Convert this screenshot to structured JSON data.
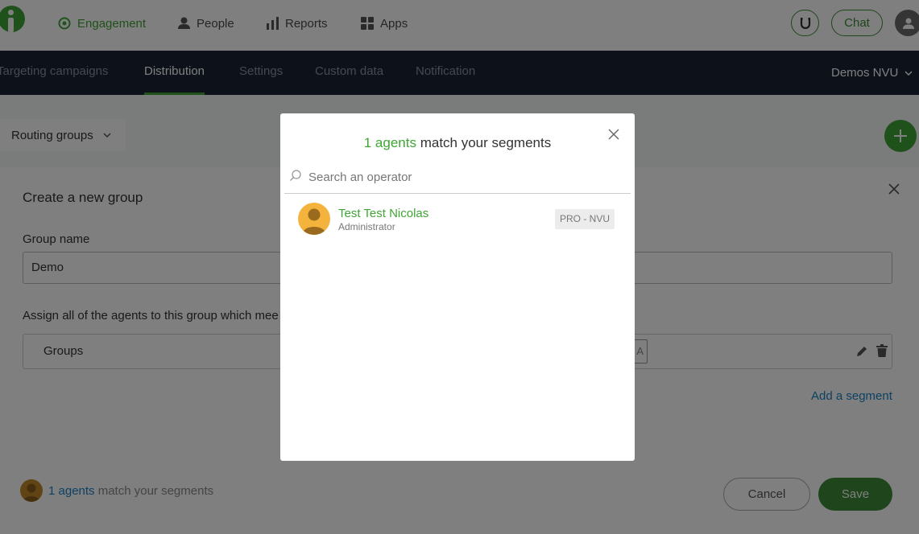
{
  "topnav": {
    "items": [
      {
        "label": "Engagement",
        "icon": "target-icon",
        "active": true
      },
      {
        "label": "People",
        "icon": "person-icon",
        "active": false
      },
      {
        "label": "Reports",
        "icon": "bar-chart-icon",
        "active": false
      },
      {
        "label": "Apps",
        "icon": "grid-icon",
        "active": false
      }
    ],
    "chat_label": "Chat"
  },
  "subnav": {
    "tabs": [
      {
        "label": "Targeting campaigns",
        "active": false
      },
      {
        "label": "Distribution",
        "active": true
      },
      {
        "label": "Settings",
        "active": false
      },
      {
        "label": "Custom data",
        "active": false
      },
      {
        "label": "Notification",
        "active": false
      }
    ],
    "account": "Demos NVU"
  },
  "page": {
    "routing_label": "Routing groups",
    "panel_title": "Create a new group",
    "group_name_label": "Group name",
    "group_name_value": "Demo",
    "assign_label": "Assign all of the agents to this group which mee",
    "segment_label": "Groups",
    "segment_tag": "A",
    "add_segment": "Add a segment",
    "footer_count": "1 agents",
    "footer_text": " match your segments",
    "cancel": "Cancel",
    "save": "Save"
  },
  "modal": {
    "title_count": "1 agents",
    "title_rest": " match your segments",
    "search_placeholder": "Search an operator",
    "operators": [
      {
        "name": "Test Test Nicolas",
        "role": "Administrator",
        "badge": "PRO - NVU"
      }
    ]
  },
  "colors": {
    "brand_green": "#3fa535",
    "dark_green": "#3d8a36",
    "subnav_bg": "#1b2535",
    "link_blue": "#1a82c4",
    "avatar_orange": "#f3b33d"
  }
}
